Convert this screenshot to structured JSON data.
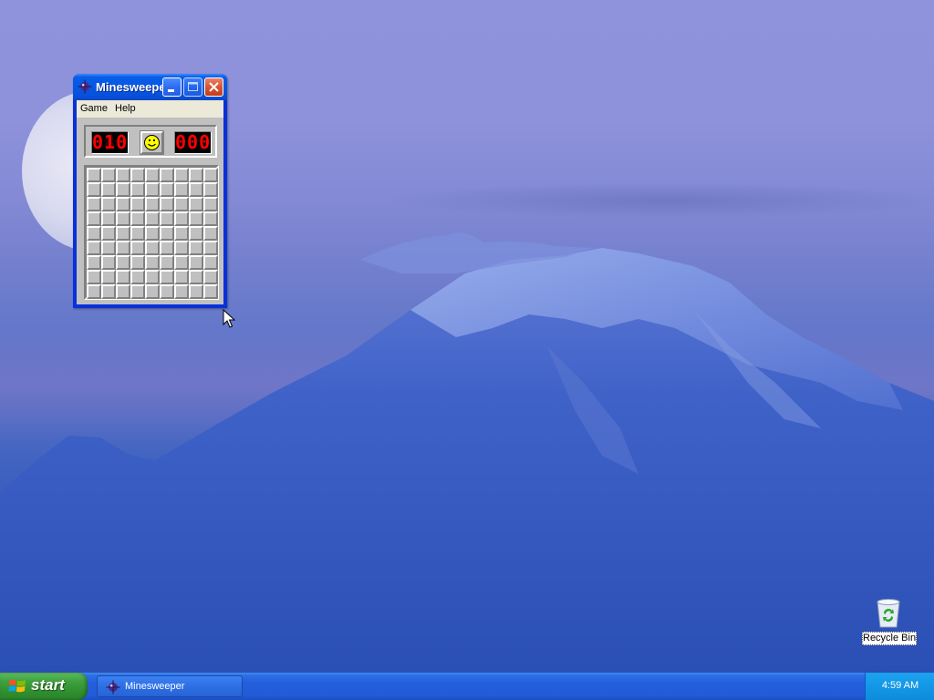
{
  "window": {
    "title": "Minesweeper",
    "title_display": "Minesweeper…",
    "menu": [
      "Game",
      "Help"
    ],
    "mine_counter": "010",
    "timer": "000",
    "board": {
      "rows": 9,
      "cols": 9
    }
  },
  "desktop": {
    "icons": [
      {
        "label": "Recycle Bin",
        "icon": "recycle-bin-icon"
      }
    ]
  },
  "taskbar": {
    "start_label": "start",
    "tasks": [
      {
        "label": "Minesweeper",
        "icon": "minesweeper-icon"
      }
    ],
    "clock": "4:59 AM"
  },
  "colors": {
    "titlebar": "#0557e5",
    "taskbar": "#245edb",
    "start_button": "#3fa13f",
    "lcd_digits": "#ff0000",
    "board_gray": "#c0c0c0"
  }
}
